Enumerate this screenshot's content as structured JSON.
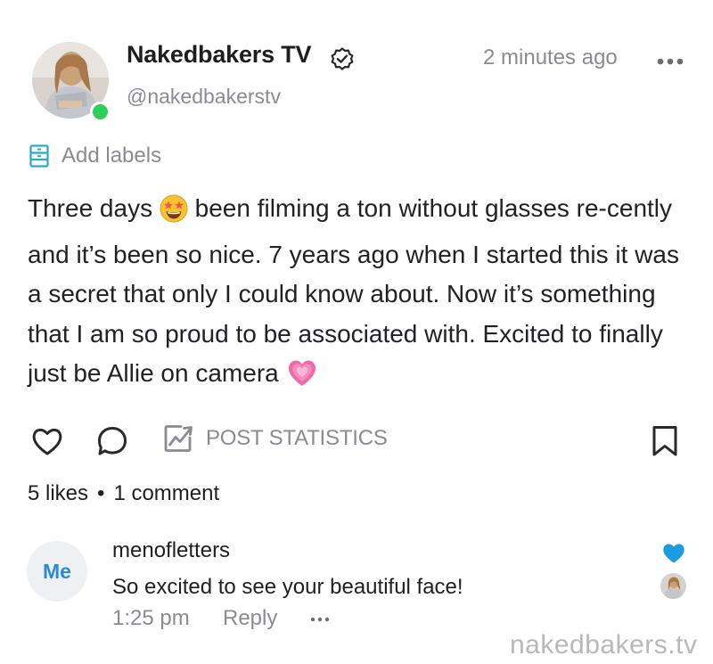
{
  "post": {
    "author_name": "Nakedbakers TV",
    "handle": "@nakedbakerstv",
    "time": "2 minutes ago",
    "add_labels": "Add labels",
    "body_parts": [
      "Three days ",
      " been filming a ton without glasses re-cently and it’s been so nice. 7 years ago when I started this it was a secret that only I could know about. Now it’s something that I am so proud to be associated with. Excited to finally just be Allie on camera "
    ],
    "emojis": [
      "star-struck-emoji",
      "growing-heart-emoji"
    ]
  },
  "actions": {
    "stats_label": "POST STATISTICS",
    "likes": "5 likes",
    "separator": "•",
    "comments": "1 comment"
  },
  "comment": {
    "avatar_text": "Me",
    "username": "menofletters",
    "text": "So excited to see your beautiful face!",
    "time": "1:25 pm",
    "reply": "Reply"
  },
  "watermark": "nakedbakers.tv",
  "icons": [
    "verified-icon",
    "more-icon",
    "label-icon",
    "heart-icon",
    "comment-icon",
    "stats-icon",
    "bookmark-icon"
  ],
  "colors": {
    "text": "#1f1f22",
    "muted": "#8a8a93",
    "accent": "#2ca9c4",
    "online": "#2fcd5a",
    "like": "#1b9be0",
    "watermark": "#b8b8bc"
  }
}
